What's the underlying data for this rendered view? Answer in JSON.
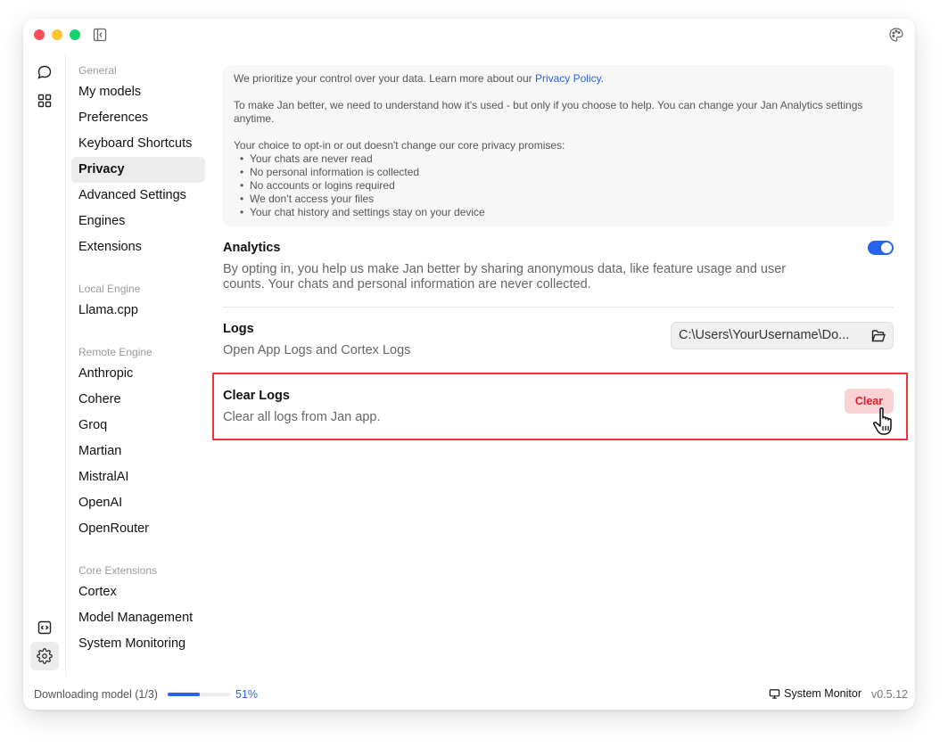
{
  "window": {
    "theme_icon": "palette-icon",
    "sidebar_toggle_icon": "sidebar-collapse-icon"
  },
  "icon_rail": {
    "top": [
      {
        "name": "chat-icon",
        "label": "Chat"
      },
      {
        "name": "grid-icon",
        "label": "Hub"
      }
    ],
    "bottom": [
      {
        "name": "code-icon",
        "label": "Local API Server"
      },
      {
        "name": "gear-icon",
        "label": "Settings",
        "active": true
      }
    ]
  },
  "nav": {
    "groups": [
      {
        "title": "General",
        "items": [
          "My models",
          "Preferences",
          "Keyboard Shortcuts",
          "Privacy",
          "Advanced Settings",
          "Engines",
          "Extensions"
        ]
      },
      {
        "title": "Local Engine",
        "items": [
          "Llama.cpp"
        ]
      },
      {
        "title": "Remote Engine",
        "items": [
          "Anthropic",
          "Cohere",
          "Groq",
          "Martian",
          "MistralAI",
          "OpenAI",
          "OpenRouter"
        ]
      },
      {
        "title": "Core Extensions",
        "items": [
          "Cortex",
          "Model Management",
          "System Monitoring"
        ]
      }
    ],
    "active": "Privacy"
  },
  "privacy_info": {
    "intro": "We prioritize your control over your data. Learn more about our ",
    "link": "Privacy Policy",
    "intro_end": ".",
    "para2": "To make Jan better, we need to understand how it's used - but only if you choose to help. You can change your Jan Analytics settings anytime.",
    "para3": "Your choice to opt-in or out doesn't change our core privacy promises:",
    "promises": [
      "Your chats are never read",
      "No personal information is collected",
      "No accounts or logins required",
      "We don’t access your files",
      "Your chat history and settings stay on your device"
    ]
  },
  "analytics": {
    "title": "Analytics",
    "description": "By opting in, you help us make Jan better by sharing anonymous data, like feature usage and user counts. Your chats and personal information are never collected.",
    "enabled": true
  },
  "logs": {
    "title": "Logs",
    "description": "Open App Logs and Cortex Logs",
    "path": "C:\\Users\\YourUsername\\Do..."
  },
  "clear_logs": {
    "title": "Clear Logs",
    "description": "Clear all logs from Jan app.",
    "button": "Clear",
    "accent": "#e11d2a"
  },
  "status": {
    "download_label": "Downloading model (1/3)",
    "progress_percent": 51,
    "progress_text": "51%",
    "system_monitor": "System Monitor",
    "version": "v0.5.12"
  },
  "colors": {
    "accent": "#2563eb",
    "highlight": "#ee3338"
  }
}
